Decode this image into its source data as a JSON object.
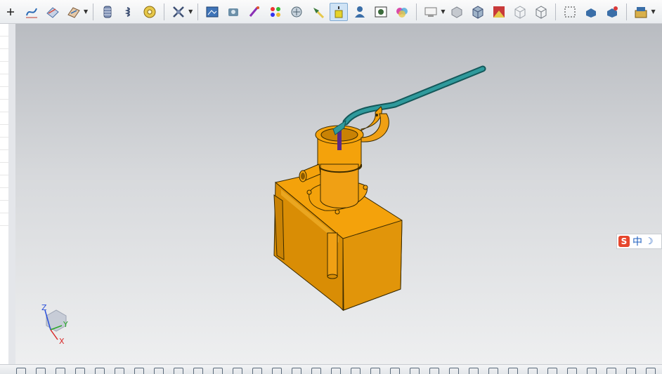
{
  "app": {
    "toolbar_top_icons": [
      "plus-icon",
      "curve-icon",
      "surface-icon",
      "sheet-icon",
      "spring-icon",
      "coil-icon",
      "cylinder-icon",
      "gear-wheel-icon",
      "scissors-icon",
      "camera-scene-icon",
      "photo-icon",
      "paint-brush-icon",
      "materials-icon",
      "texture-icon",
      "spotlight-icon",
      "light-source-icon",
      "person-icon",
      "background-icon",
      "color-palette-icon",
      "display-icon",
      "shaded-box-icon",
      "cube-icon",
      "render-icon",
      "wireframe-cube-icon",
      "hidden-line-cube-icon",
      "view-frame-icon",
      "section-view-icon",
      "face-highlight-icon",
      "edit-window-icon"
    ],
    "active_icon": "light-source-icon",
    "ime": {
      "logo": "S",
      "lang": "中",
      "moon": "☽"
    },
    "triad": {
      "z": "Z",
      "y": "Y",
      "x": "X"
    },
    "colors": {
      "part": "#f4a20b",
      "handle": "#1e7a7c",
      "background_top": "#b9bcc1",
      "background_bottom": "#eeeff0"
    }
  }
}
